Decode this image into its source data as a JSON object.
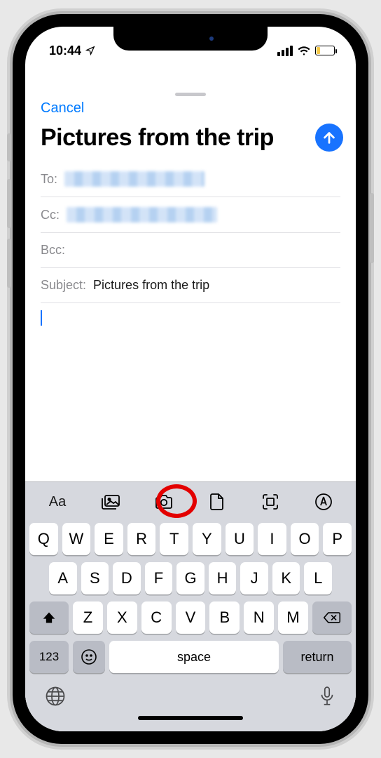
{
  "status": {
    "time": "10:44"
  },
  "compose": {
    "cancel": "Cancel",
    "title": "Pictures from the trip",
    "fields": {
      "to_label": "To:",
      "cc_label": "Cc:",
      "bcc_label": "Bcc:",
      "subject_label": "Subject:",
      "subject_value": "Pictures from the trip"
    }
  },
  "toolbar": {
    "items": [
      "text-format",
      "photo-library",
      "camera",
      "document",
      "scan",
      "markup"
    ]
  },
  "keyboard": {
    "row1": [
      "Q",
      "W",
      "E",
      "R",
      "T",
      "Y",
      "U",
      "I",
      "O",
      "P"
    ],
    "row2": [
      "A",
      "S",
      "D",
      "F",
      "G",
      "H",
      "J",
      "K",
      "L"
    ],
    "row3": [
      "Z",
      "X",
      "C",
      "V",
      "B",
      "N",
      "M"
    ],
    "numbers": "123",
    "space": "space",
    "return": "return"
  }
}
